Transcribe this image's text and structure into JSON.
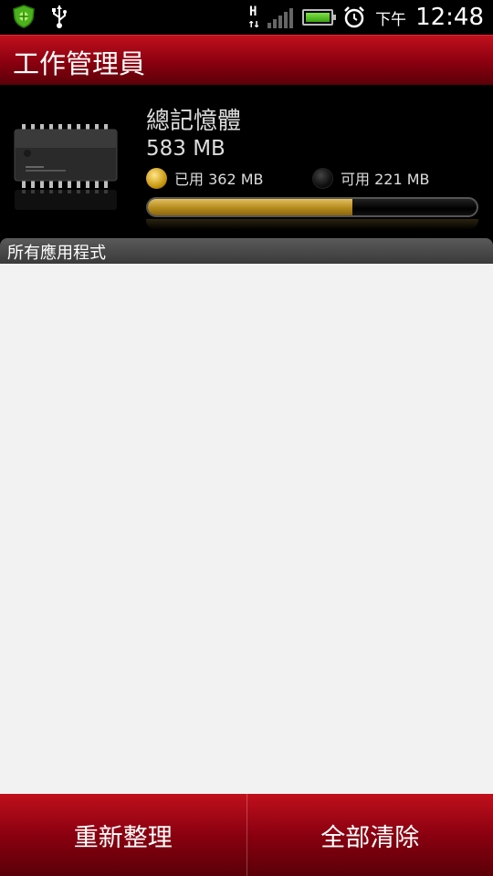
{
  "status_bar": {
    "network_type": "H",
    "ampm": "下午",
    "time": "12:48",
    "icons": [
      "shield-icon",
      "usb-icon",
      "signal-icon",
      "battery-icon",
      "alarm-icon"
    ]
  },
  "header": {
    "title": "工作管理員"
  },
  "memory": {
    "title": "總記憶體",
    "total": "583 MB",
    "used_label": "已用 362 MB",
    "free_label": "可用 221 MB",
    "used_fraction": 0.621
  },
  "section": {
    "label": "所有應用程式"
  },
  "buttons": {
    "refresh": "重新整理",
    "clear_all": "全部清除"
  },
  "colors": {
    "accent_red": "#8a0010",
    "gold": "#c99a10",
    "list_bg": "#f2f2f2"
  }
}
